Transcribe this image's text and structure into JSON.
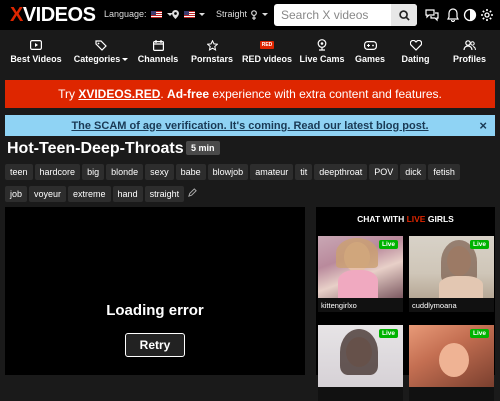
{
  "header": {
    "logo_x": "X",
    "logo_rest": "VIDEOS",
    "language_label": "Language:",
    "straight_label": "Straight",
    "search_placeholder": "Search X videos"
  },
  "nav": [
    {
      "label": "Best Videos",
      "icon": "play-square-icon"
    },
    {
      "label": "Categories",
      "icon": "tags-icon"
    },
    {
      "label": "Channels",
      "icon": "calendar-icon"
    },
    {
      "label": "Pornstars",
      "icon": "star-icon"
    },
    {
      "label": "RED videos",
      "icon": "red-badge-icon",
      "badge": "RED"
    },
    {
      "label": "Live Cams",
      "icon": "webcam-icon"
    },
    {
      "label": "Games",
      "icon": "gamepad-icon"
    },
    {
      "label": "Dating",
      "icon": "heart-icon"
    },
    {
      "label": "Profiles",
      "icon": "users-icon"
    }
  ],
  "red_banner": {
    "pre": "Try ",
    "link": "XVIDEOS.RED",
    "mid": ". ",
    "bold": "Ad-free",
    "post": " experience with extra content and features."
  },
  "blue_banner": {
    "text": "The SCAM of age verification. It's coming. Read our latest blog post.",
    "close": "×"
  },
  "video": {
    "title": "Hot-Teen-Deep-Throats",
    "duration": "5 min",
    "tags": [
      "teen",
      "hardcore",
      "big",
      "blonde",
      "sexy",
      "babe",
      "blowjob",
      "amateur",
      "tit",
      "deepthroat",
      "POV",
      "dick",
      "fetish",
      "job",
      "voyeur",
      "extreme",
      "hand",
      "straight"
    ],
    "error": "Loading error",
    "retry": "Retry"
  },
  "chat": {
    "head_pre": "CHAT WITH ",
    "head_live": "LIVE",
    "head_post": " GIRLS",
    "live_badge": "Live",
    "cams": [
      {
        "name": "kittengirlxo"
      },
      {
        "name": "cuddlymoana"
      },
      {
        "name": ""
      },
      {
        "name": ""
      }
    ]
  },
  "colors": {
    "brand_red": "#de2600",
    "banner_blue": "#8fd3f4",
    "live_green": "#00b300"
  }
}
